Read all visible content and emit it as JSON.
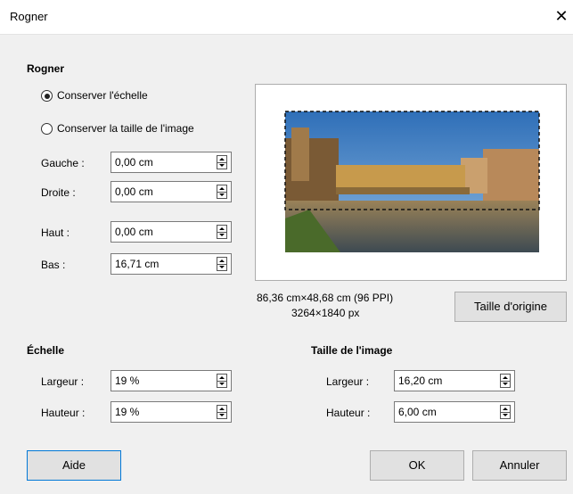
{
  "window": {
    "title": "Rogner"
  },
  "crop": {
    "section_title": "Rogner",
    "keep_scale": {
      "label": "Conserver l'échelle",
      "selected": true
    },
    "keep_size": {
      "label": "Conserver la taille de l'image",
      "selected": false
    },
    "left": {
      "label": "Gauche :",
      "value": "0,00 cm"
    },
    "right": {
      "label": "Droite :",
      "value": "0,00 cm"
    },
    "top": {
      "label": "Haut :",
      "value": "0,00 cm"
    },
    "bottom": {
      "label": "Bas :",
      "value": "16,71 cm"
    }
  },
  "preview": {
    "dimensions_cm": "86,36 cm×48,68 cm (96 PPI)",
    "dimensions_px": "3264×1840 px",
    "original_size_label": "Taille d'origine"
  },
  "scale": {
    "section_title": "Échelle",
    "width": {
      "label": "Largeur :",
      "value": "19 %"
    },
    "height": {
      "label": "Hauteur :",
      "value": "19 %"
    }
  },
  "image_size": {
    "section_title": "Taille de l'image",
    "width": {
      "label": "Largeur :",
      "value": "16,20 cm"
    },
    "height": {
      "label": "Hauteur :",
      "value": "6,00 cm"
    }
  },
  "buttons": {
    "help": "Aide",
    "ok": "OK",
    "cancel": "Annuler"
  },
  "icons": {
    "close": "close-icon",
    "radio": "radio-icon",
    "spin": "spin-arrows-icon"
  },
  "colors": {
    "accent": "#0078d7",
    "background": "#f0f0f0"
  }
}
